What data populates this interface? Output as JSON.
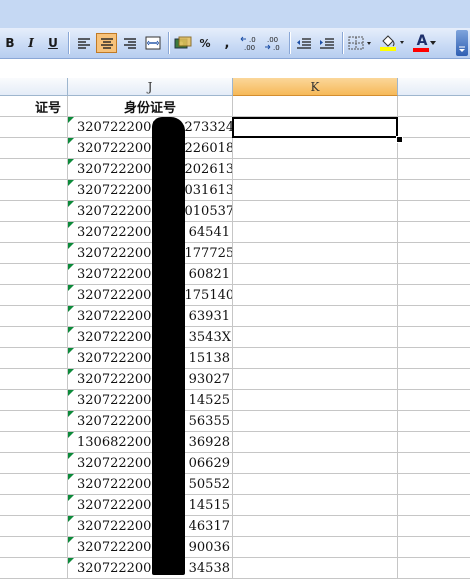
{
  "toolbar": {
    "bold": "B",
    "italic": "I",
    "underline": "U",
    "percent": "%",
    "comma": ",",
    "increase_decimal": "←.0 .00",
    "decrease_decimal": ".00 →.0",
    "font_color_letter": "A",
    "icons": [
      "align-left-icon",
      "align-center-icon",
      "align-right-icon",
      "merge-center-icon",
      "currency-icon",
      "decrease-indent-icon",
      "increase-indent-icon",
      "borders-icon",
      "fill-color-icon",
      "font-color-icon"
    ]
  },
  "columns": {
    "j": "J",
    "k": "K"
  },
  "sheet": {
    "left_header": "证号",
    "header_j": "身份证号",
    "rows": [
      "3207222005      273324",
      "3207222005      226018",
      "3207222006      202613",
      "3207222006      031613",
      "3207222006      010537",
      "3207222005       64541",
      "3207222006      177725",
      "3207222006       60821",
      "3207222006      175140",
      "3207222006       63931",
      "3207222006       3543X",
      "3207222006       15138",
      "3207222006       93027",
      "3207222006       14525",
      "3207222006       56355",
      "1306822006       36928",
      "3207222006       06629",
      "3207222005       50552",
      "3207222006       14515",
      "3207222005       46317",
      "3207222005       90036",
      "3207222006       34538"
    ]
  },
  "colors": {
    "toolbar": "#c8daf5",
    "selected_column_header": "#f6b959",
    "gridline": "#c6c6c6",
    "error_indicator": "#0c8a3a",
    "redaction": "#000000"
  }
}
